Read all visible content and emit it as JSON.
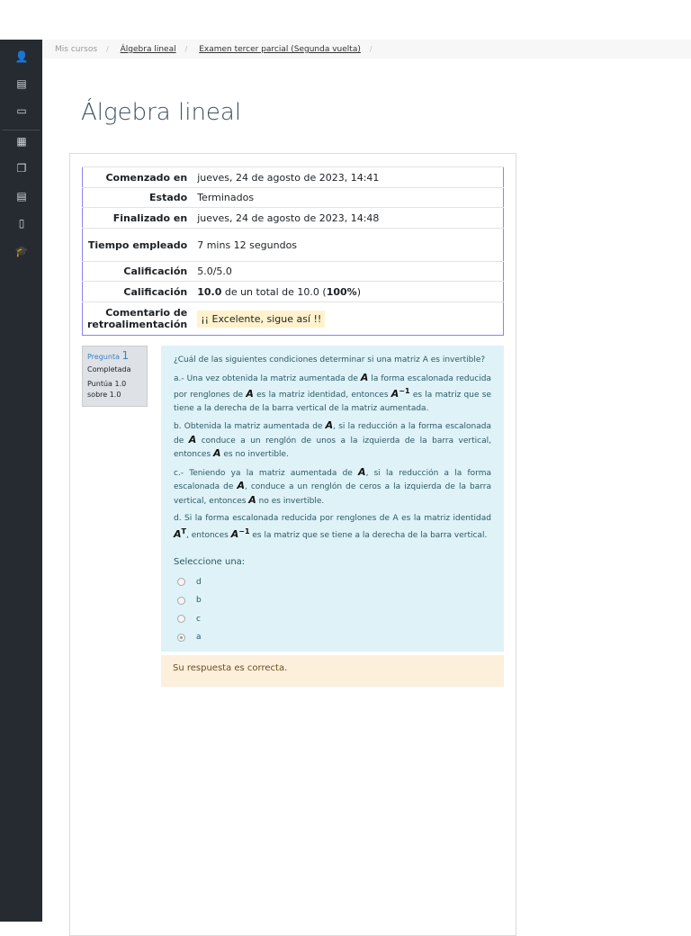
{
  "breadcrumb": [
    "Mis cursos",
    "Álgebra lineal",
    "Examen tercer parcial (Segunda vuelta)"
  ],
  "page_title": "Álgebra lineal",
  "summary": [
    {
      "label": "Comenzado en",
      "value": "jueves, 24 de agosto de 2023, 14:41"
    },
    {
      "label": "Estado",
      "value": "Terminados"
    },
    {
      "label": "Finalizado en",
      "value": "jueves, 24 de agosto de 2023, 14:48"
    },
    {
      "label": "Tiempo empleado",
      "value": "7 mins 12 segundos"
    },
    {
      "label": "Calificación",
      "value": "5.0/5.0"
    },
    {
      "label": "Calificación",
      "value_bold": "10.0",
      "value_mid": " de un total de 10.0 (",
      "value_pct": "100%",
      "value_end": ")"
    },
    {
      "label": "Comentario de retroalimentación",
      "value": "¡¡ Excelente, sigue así !!"
    }
  ],
  "question": {
    "label": "Pregunta",
    "number": "1",
    "state": "Completada",
    "score": "Puntúa 1.0 sobre 1.0",
    "text": "¿Cuál de las siguientes condiciones determinar si una matriz A es invertible?",
    "a": [
      "a.- Una vez obtenida la matriz aumentada de ",
      "A",
      " la forma escalonada reducida por renglones de ",
      "A",
      " es la matriz identidad, entonces ",
      "A",
      "−1",
      " es la matriz que se tiene a la derecha de la barra vertical de la matriz aumentada."
    ],
    "b": [
      "b. Obtenida la matriz aumentada de ",
      "A",
      ", si la reducción a la forma escalonada de ",
      "A",
      " conduce a un renglón de unos a la izquierda de la barra vertical, entonces ",
      "A",
      " es no invertible."
    ],
    "c": [
      "c.- Teniendo ya la matriz aumentada de ",
      "A",
      ", si la reducción a la forma escalonada de ",
      "A",
      ", conduce a un renglón de ceros a la izquierda de la barra vertical, entonces ",
      "A",
      " no es invertible."
    ],
    "d": [
      "d. Si la forma escalonada reducida por renglones de A es la matriz identidad ",
      "A",
      "T",
      ", entonces ",
      "A",
      "−1",
      " es la matriz que se tiene a la derecha de la barra vertical."
    ],
    "prompt": "Seleccione una:",
    "options": [
      "d",
      "b",
      "c",
      "a"
    ],
    "selected": "a",
    "feedback": "Su respuesta es correcta."
  }
}
